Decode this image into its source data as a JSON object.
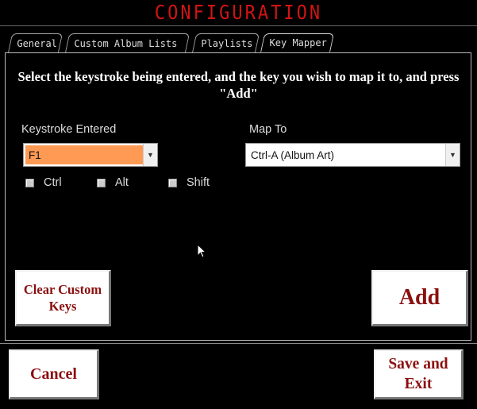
{
  "title": "CONFIGURATION",
  "tabs": [
    {
      "label": "General"
    },
    {
      "label": "Custom Album Lists"
    },
    {
      "label": "Playlists"
    },
    {
      "label": "Key Mapper"
    }
  ],
  "instruction": "Select the keystroke being entered, and the key you wish to map it to, and press \"Add\"",
  "keystroke": {
    "label": "Keystroke Entered",
    "value": "F1",
    "highlight_color": "#ff9a55"
  },
  "map_to": {
    "label": "Map To",
    "value": "Ctrl-A (Album Art)"
  },
  "modifiers": {
    "ctrl": "Ctrl",
    "alt": "Alt",
    "shift": "Shift"
  },
  "buttons": {
    "clear": "Clear Custom Keys",
    "add": "Add",
    "cancel": "Cancel",
    "save": "Save and Exit"
  },
  "colors": {
    "title": "#d11414",
    "button_text": "#8b0f0f"
  }
}
